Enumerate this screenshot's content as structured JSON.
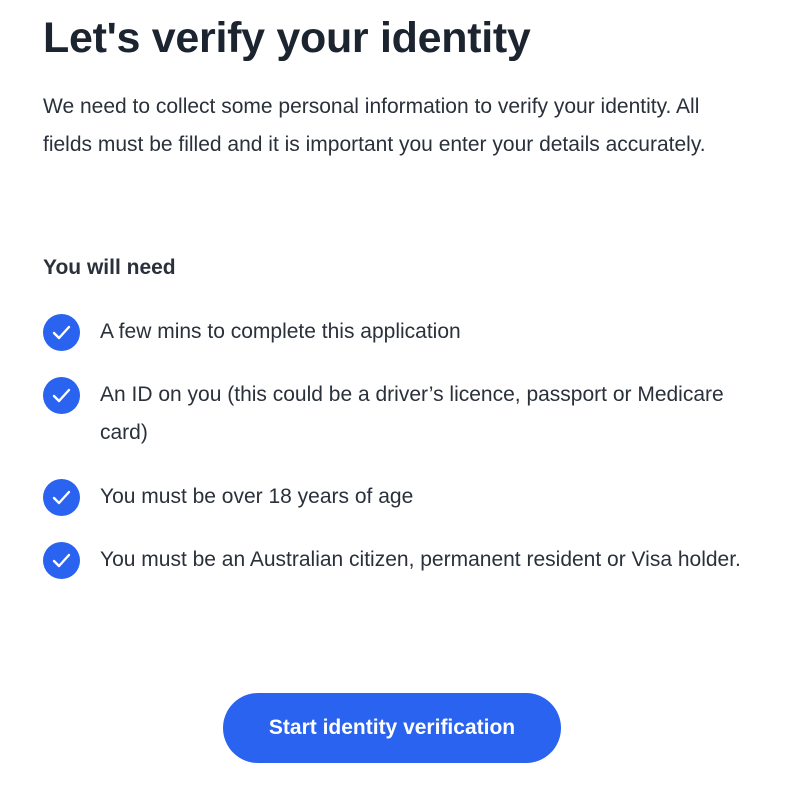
{
  "page": {
    "title": "Let's verify your identity",
    "intro": "We need to collect some personal information to verify your identity. All fields must be filled and it is important you enter your details accurately."
  },
  "requirements": {
    "heading": "You will need",
    "items": [
      {
        "text": "A few mins to complete this application",
        "icon": "check-circle-icon"
      },
      {
        "text": "An ID on you (this could be a driver’s licence, passport or Medicare card)",
        "icon": "check-circle-icon"
      },
      {
        "text": "You must be over 18 years of age",
        "icon": "check-circle-icon"
      },
      {
        "text": "You must be an Australian citizen, permanent resident or Visa holder.",
        "icon": "check-circle-icon"
      }
    ]
  },
  "actions": {
    "start_label": "Start identity verification"
  },
  "colors": {
    "accent": "#2963f0",
    "text": "#2a313b",
    "heading": "#1c2430"
  }
}
